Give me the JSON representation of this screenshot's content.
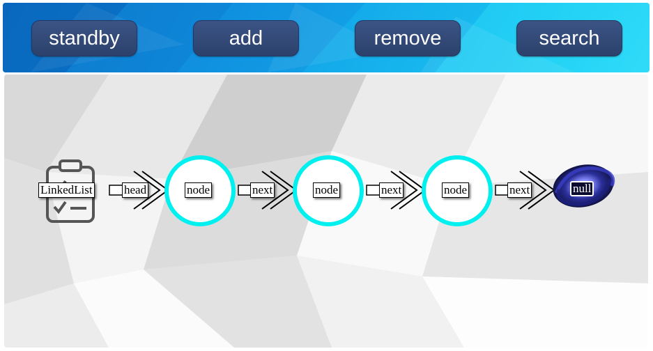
{
  "toolbar": {
    "standby_label": "standby",
    "add_label": "add",
    "remove_label": "remove",
    "search_label": "search"
  },
  "list": {
    "head_label": "LinkedList",
    "head_pointer_label": "head",
    "head_icon": "clipboard-checklist-icon",
    "nodes": [
      {
        "label": "node",
        "pointer_label": "next"
      },
      {
        "label": "node",
        "pointer_label": "next"
      },
      {
        "label": "node",
        "pointer_label": "next"
      }
    ],
    "tail_label": "null",
    "tail_icon": "galaxy-swirl-icon"
  },
  "colors": {
    "node_ring": "#00f0f0",
    "button_bg": "#34497a",
    "toolbar_bg": "#14a8e8"
  }
}
